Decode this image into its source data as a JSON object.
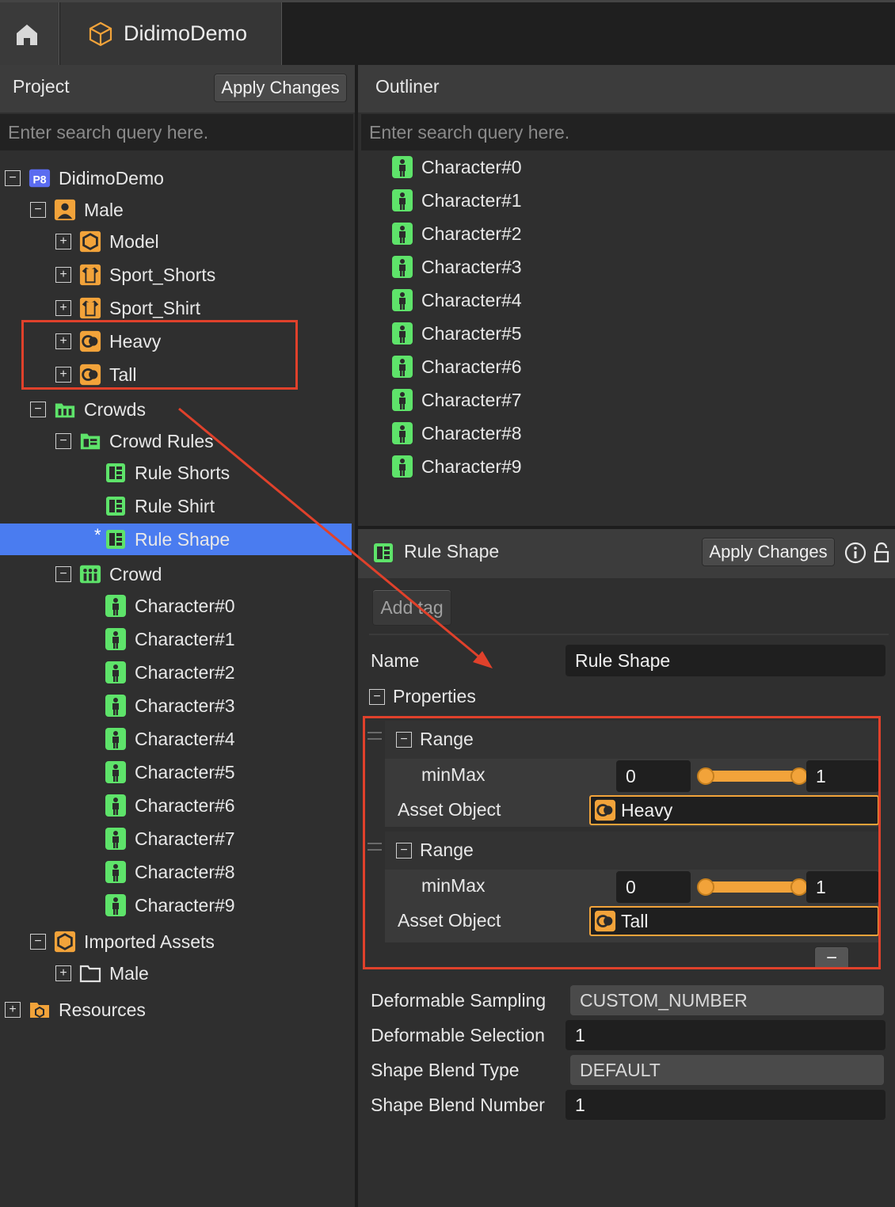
{
  "tabs": {
    "project_tab": "DidimoDemo"
  },
  "left": {
    "title": "Project",
    "apply_label": "Apply Changes",
    "search_placeholder": "Enter search query here.",
    "tree": [
      {
        "label": "DidimoDemo",
        "icon": "p8-project-icon",
        "toggle": "−"
      },
      {
        "label": "Male",
        "icon": "person-icon",
        "toggle": "−"
      },
      {
        "label": "Model",
        "icon": "hexagon-model-icon",
        "toggle": "+"
      },
      {
        "label": "Sport_Shorts",
        "icon": "garment-icon",
        "toggle": "+"
      },
      {
        "label": "Sport_Shirt",
        "icon": "garment-icon",
        "toggle": "+"
      },
      {
        "label": "Heavy",
        "icon": "shape-icon",
        "toggle": "+"
      },
      {
        "label": "Tall",
        "icon": "shape-icon",
        "toggle": "+"
      },
      {
        "label": "Crowds",
        "icon": "crowd-folder-icon",
        "toggle": "−"
      },
      {
        "label": "Crowd Rules",
        "icon": "rules-folder-icon",
        "toggle": "−"
      },
      {
        "label": "Rule Shorts",
        "icon": "rule-icon",
        "toggle": ""
      },
      {
        "label": "Rule Shirt",
        "icon": "rule-icon",
        "toggle": ""
      },
      {
        "label": "Rule Shape",
        "icon": "rule-icon",
        "toggle": "",
        "modified": "*"
      },
      {
        "label": "Crowd",
        "icon": "crowd-icon",
        "toggle": "−"
      },
      {
        "label": "Character#0",
        "icon": "character-icon",
        "toggle": ""
      },
      {
        "label": "Character#1",
        "icon": "character-icon",
        "toggle": ""
      },
      {
        "label": "Character#2",
        "icon": "character-icon",
        "toggle": ""
      },
      {
        "label": "Character#3",
        "icon": "character-icon",
        "toggle": ""
      },
      {
        "label": "Character#4",
        "icon": "character-icon",
        "toggle": ""
      },
      {
        "label": "Character#5",
        "icon": "character-icon",
        "toggle": ""
      },
      {
        "label": "Character#6",
        "icon": "character-icon",
        "toggle": ""
      },
      {
        "label": "Character#7",
        "icon": "character-icon",
        "toggle": ""
      },
      {
        "label": "Character#8",
        "icon": "character-icon",
        "toggle": ""
      },
      {
        "label": "Character#9",
        "icon": "character-icon",
        "toggle": ""
      },
      {
        "label": "Imported Assets",
        "icon": "hexagon-model-icon",
        "toggle": "−"
      },
      {
        "label": "Male",
        "icon": "folder-icon",
        "toggle": "+"
      },
      {
        "label": "Resources",
        "icon": "resources-folder-icon",
        "toggle": "+"
      }
    ]
  },
  "outliner": {
    "title": "Outliner",
    "search_placeholder": "Enter search query here.",
    "items": [
      "Character#0",
      "Character#1",
      "Character#2",
      "Character#3",
      "Character#4",
      "Character#5",
      "Character#6",
      "Character#7",
      "Character#8",
      "Character#9"
    ]
  },
  "inspector": {
    "title": "Rule Shape",
    "apply_label": "Apply Changes",
    "add_tag_label": "Add tag",
    "name_label": "Name",
    "name_value": "Rule Shape",
    "properties_label": "Properties",
    "ranges": [
      {
        "label": "Range",
        "minmax_label": "minMax",
        "min": "0",
        "max": "1",
        "asset_label": "Asset Object",
        "asset": "Heavy"
      },
      {
        "label": "Range",
        "minmax_label": "minMax",
        "min": "0",
        "max": "1",
        "asset_label": "Asset Object",
        "asset": "Tall"
      }
    ],
    "remove_label": "−",
    "fields": [
      {
        "label": "Deformable Sampling",
        "value": "CUSTOM_NUMBER",
        "kind": "dropdown"
      },
      {
        "label": "Deformable Selection",
        "value": "1",
        "kind": "number"
      },
      {
        "label": "Shape Blend Type",
        "value": "DEFAULT",
        "kind": "dropdown"
      },
      {
        "label": "Shape Blend Number",
        "value": "1",
        "kind": "number"
      }
    ]
  },
  "colors": {
    "accent": "#f2a33a",
    "selection": "#4a7cf0",
    "highlight": "#e0412b",
    "character": "#5ee36a"
  }
}
